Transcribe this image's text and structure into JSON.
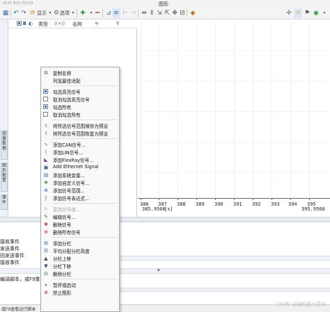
{
  "window": {
    "title": "图形",
    "caption": "2024 年03 月22日"
  },
  "toolbar": {
    "display_label": "显示",
    "options_label": "选项",
    "icons": [
      "grid-icon",
      "undo-icon",
      "redo-icon",
      "refresh-icon",
      "add-icon",
      "remove-icon",
      "fit-icon",
      "multi-axis-icon",
      "cursor-a-icon",
      "cursor-b-icon",
      "zoom-x-icon",
      "zoom-y-icon",
      "expand-icon",
      "shrink-icon",
      "pan-icon",
      "measure-icon",
      "marker-icon",
      "settings-icon",
      "help-icon"
    ]
  },
  "signal_list": {
    "columns": {
      "type": "类型",
      "name": "名称",
      "y": "Y"
    }
  },
  "left_tabs": [
    "测量数据",
    "图形配置",
    "事件"
  ],
  "chart": {
    "x_ticks": [
      "386",
      "387",
      "388",
      "389",
      "390",
      "391",
      "392",
      "393",
      "394",
      "395"
    ],
    "range_start": "385.9560",
    "range_unit": "[s]",
    "range_end": "395.9560"
  },
  "bottom": {
    "events": [
      "接收事件",
      "发送事件",
      "回发送事件",
      "接收事件"
    ],
    "hint": "编译脚本，或F9重",
    "status": "或F9查看运行脚本"
  },
  "watermark": "CSDN @骑机器小菜鸟",
  "context_menu": {
    "items": [
      {
        "label": "复制名称",
        "icon": "copy-icon",
        "disabled": false
      },
      {
        "label": "列宽最佳适配",
        "icon": "none",
        "disabled": false
      },
      {
        "label": "勾选高亮信号",
        "icon": "checkbox-on",
        "disabled": false
      },
      {
        "label": "取消勾选高亮信号",
        "icon": "checkbox-off",
        "disabled": false
      },
      {
        "label": "勾选所有",
        "icon": "checkbox-on",
        "disabled": false
      },
      {
        "label": "取消勾选所有",
        "icon": "checkbox-off",
        "disabled": false
      },
      {
        "label": "将所选信号范围保存为预设",
        "icon": "save-preset-icon",
        "disabled": false
      },
      {
        "label": "将所选信号范围恢复为预设",
        "icon": "restore-preset-icon",
        "disabled": false
      },
      {
        "label": "添加CAN信号...",
        "icon": "can-icon",
        "disabled": false
      },
      {
        "label": "添加LIN信号...",
        "icon": "lin-icon",
        "disabled": false
      },
      {
        "label": "添加FlexRay信号...",
        "icon": "flexray-icon",
        "disabled": false
      },
      {
        "label": "Add Ethernet Signal",
        "icon": "ethernet-icon",
        "disabled": false
      },
      {
        "label": "添加系统变量...",
        "icon": "sysvar-icon",
        "disabled": false
      },
      {
        "label": "添加自定义信号...",
        "icon": "custom-signal-icon",
        "disabled": false
      },
      {
        "label": "添加信号范围...",
        "icon": "range-icon",
        "disabled": false
      },
      {
        "label": "添加信号表达式...",
        "icon": "expression-icon",
        "disabled": false
      },
      {
        "label": "更改信号值...",
        "icon": "edit-value-icon",
        "disabled": true
      },
      {
        "label": "编辑信号...",
        "icon": "edit-icon",
        "disabled": false
      },
      {
        "label": "删除信号",
        "icon": "delete-icon",
        "disabled": false
      },
      {
        "label": "删除所有信号",
        "icon": "delete-all-icon",
        "disabled": false
      },
      {
        "label": "添加分栏",
        "icon": "add-column-icon",
        "disabled": false
      },
      {
        "label": "平均分配分栏高度",
        "icon": "distribute-icon",
        "disabled": false
      },
      {
        "label": "分栏上移",
        "icon": "move-up-icon",
        "disabled": false
      },
      {
        "label": "分栏下移",
        "icon": "move-down-icon",
        "disabled": false
      },
      {
        "label": "删除分栏",
        "icon": "remove-column-icon",
        "disabled": false
      },
      {
        "label": "暂停或启动",
        "icon": "pause-icon",
        "disabled": false
      },
      {
        "label": "禁止图形",
        "icon": "disable-icon",
        "disabled": false
      }
    ]
  },
  "colors": {
    "accent": "#2e6fb5",
    "add_green": "#2a9a3a",
    "delete_red": "#d33434"
  }
}
